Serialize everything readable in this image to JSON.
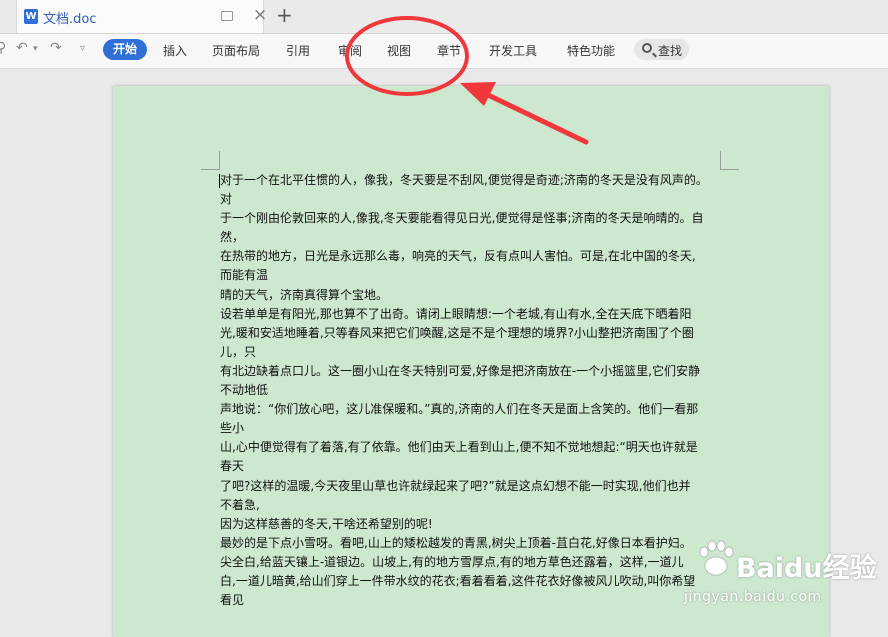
{
  "tab": {
    "title": "文档.doc",
    "doc_icon_letter": "W"
  },
  "toolbar": {
    "menu": [
      "开始",
      "插入",
      "页面布局",
      "引用",
      "审阅",
      "视图",
      "章节",
      "开发工具",
      "特色功能"
    ],
    "search_label": "查找"
  },
  "document": {
    "lines": [
      "对于一个在北平住惯的人，像我，冬天要是不刮风,便觉得是奇迹;济南的冬天是没有风声的。",
      "对",
      "于一个刚由伦敦回来的人,像我,冬天要能看得见日光,便觉得是怪事;济南的冬天是响晴的。自",
      "然，",
      "在热带的地方，日光是永远那么毒，响亮的天气，反有点叫人害怕。可是,在北中国的冬天,",
      "而能有温",
      "晴的天气，济南真得算个宝地。",
      "设若单单是有阳光,那也算不了出奇。请闭上眼睛想:一个老城,有山有水,全在天底下晒着阳",
      "光,暖和安适地睡着,只等春风来把它们唤醒,这是不是个理想的境界?小山整把济南围了个圈",
      "儿，只",
      "有北边缺着点口儿。这一圈小山在冬天特别可爱,好像是把济南放在-一个小摇篮里,它们安静",
      "不动地低",
      "声地说：“你们放心吧，这儿准保暖和。”真的,济南的人们在冬天是面上含笑的。他们一看那",
      "些小",
      "山,心中便觉得有了着落,有了依靠。他们由天上看到山上,便不知不觉地想起:“明天也许就是",
      "春天",
      "了吧?这样的温暖,今天夜里山草也许就绿起来了吧?”就是这点幻想不能一时实现,他们也并",
      "不着急,",
      "因为这样慈善的冬天,干啥还希望别的呢!",
      "最妙的是下点小雪呀。看吧,山上的矮松越发的青黑,树尖上顶着-苴白花,好像日本看护妇。",
      "尖全白,给蓝天镶上-道银边。山坡上,有的地方雪厚点,有的地方草色还露着，这样,一道儿",
      "白,一道儿暗黄,给山们穿上一件带水纹的花衣;看着看着,这件花衣好像被风儿吹动,叫你希望",
      "看见"
    ]
  },
  "annotation": {
    "color": "#f0383c"
  },
  "watermark": {
    "brand": "Baidu经验",
    "url": "jingyan.baidu.com"
  }
}
